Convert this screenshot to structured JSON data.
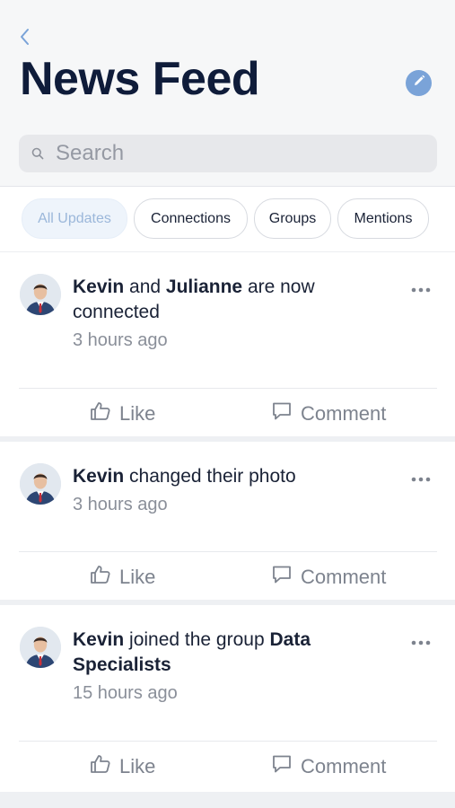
{
  "header": {
    "title": "News Feed"
  },
  "search": {
    "placeholder": "Search"
  },
  "filters": [
    {
      "label": "All Updates"
    },
    {
      "label": "Connections"
    },
    {
      "label": "Groups"
    },
    {
      "label": "Mentions"
    }
  ],
  "posts": [
    {
      "actor": "Kevin",
      "middle": " and ",
      "object": "Julianne",
      "tail": " are now connected",
      "time": "3 hours ago"
    },
    {
      "actor": "Kevin",
      "middle": " changed their photo",
      "object": "",
      "tail": "",
      "time": "3 hours ago"
    },
    {
      "actor": "Kevin",
      "middle": " joined the group ",
      "object": "Data Specialists",
      "tail": "",
      "time": "15 hours ago"
    }
  ],
  "actions": {
    "like_label": "Like",
    "comment_label": "Comment"
  },
  "colors": {
    "accent": "#7aa3d8",
    "title": "#0f1c3a",
    "muted": "#8a8f99"
  },
  "icons": {
    "back": "chevron-left-icon",
    "edit": "pencil-icon",
    "search": "search-icon",
    "more": "more-horizontal-icon",
    "like": "thumbs-up-icon",
    "comment": "comment-icon"
  }
}
